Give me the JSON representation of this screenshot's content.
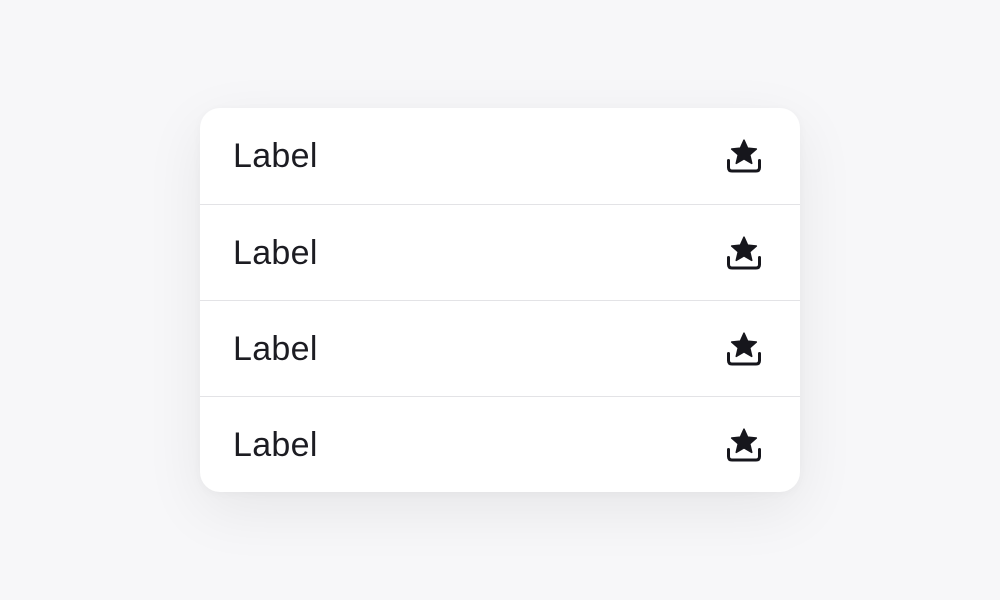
{
  "menu": {
    "items": [
      {
        "label": "Label",
        "icon": "star-download-icon"
      },
      {
        "label": "Label",
        "icon": "star-download-icon"
      },
      {
        "label": "Label",
        "icon": "star-download-icon"
      },
      {
        "label": "Label",
        "icon": "star-download-icon"
      }
    ]
  },
  "colors": {
    "background": "#F7F7F9",
    "card": "#FFFFFF",
    "text": "#1C1C22",
    "icon": "#16161C",
    "divider": "#E3E3E6"
  }
}
